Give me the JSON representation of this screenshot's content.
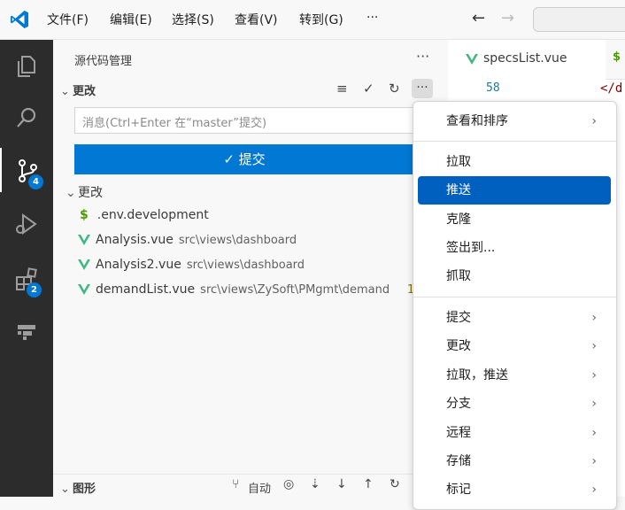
{
  "menubar": {
    "items": [
      "文件(F)",
      "编辑(E)",
      "选择(S)",
      "查看(V)",
      "转到(G)"
    ],
    "more": "···",
    "back": "←",
    "forward": "→"
  },
  "activity": {
    "scm_badge": "4",
    "extensions_badge": "2"
  },
  "sidebar": {
    "title": "源代码管理",
    "more": "···",
    "section_label": "更改",
    "message_placeholder": "消息(Ctrl+Enter 在“master”提交)",
    "commit_label": "提交",
    "changes_label": "更改",
    "files": [
      {
        "name": ".env.development",
        "path": "",
        "icon": "dollar"
      },
      {
        "name": "Analysis.vue",
        "path": "src\\views\\dashboard",
        "icon": "vue"
      },
      {
        "name": "Analysis2.vue",
        "path": "src\\views\\dashboard",
        "icon": "vue"
      },
      {
        "name": "demandList.vue",
        "path": "src\\views\\ZySoft\\PMgmt\\demand",
        "icon": "vue",
        "status": "1"
      }
    ],
    "graph_label": "图形",
    "graph_auto": "自动"
  },
  "editor": {
    "tab_label": "specsList.vue",
    "line_number": "58",
    "code": "</d"
  },
  "context_menu": {
    "items": [
      {
        "label": "查看和排序",
        "submenu": true
      },
      {
        "label": "拉取",
        "submenu": false
      },
      {
        "label": "推送",
        "submenu": false,
        "active": true
      },
      {
        "label": "克隆",
        "submenu": false
      },
      {
        "label": "签出到...",
        "submenu": false
      },
      {
        "label": "抓取",
        "submenu": false
      },
      {
        "label": "提交",
        "submenu": true
      },
      {
        "label": "更改",
        "submenu": true
      },
      {
        "label": "拉取，推送",
        "submenu": true
      },
      {
        "label": "分支",
        "submenu": true
      },
      {
        "label": "远程",
        "submenu": true
      },
      {
        "label": "存储",
        "submenu": true
      },
      {
        "label": "标记",
        "submenu": true
      }
    ]
  },
  "colors": {
    "accent": "#0078d4",
    "menu_active": "#0060c0",
    "vue_green": "#41b883"
  }
}
